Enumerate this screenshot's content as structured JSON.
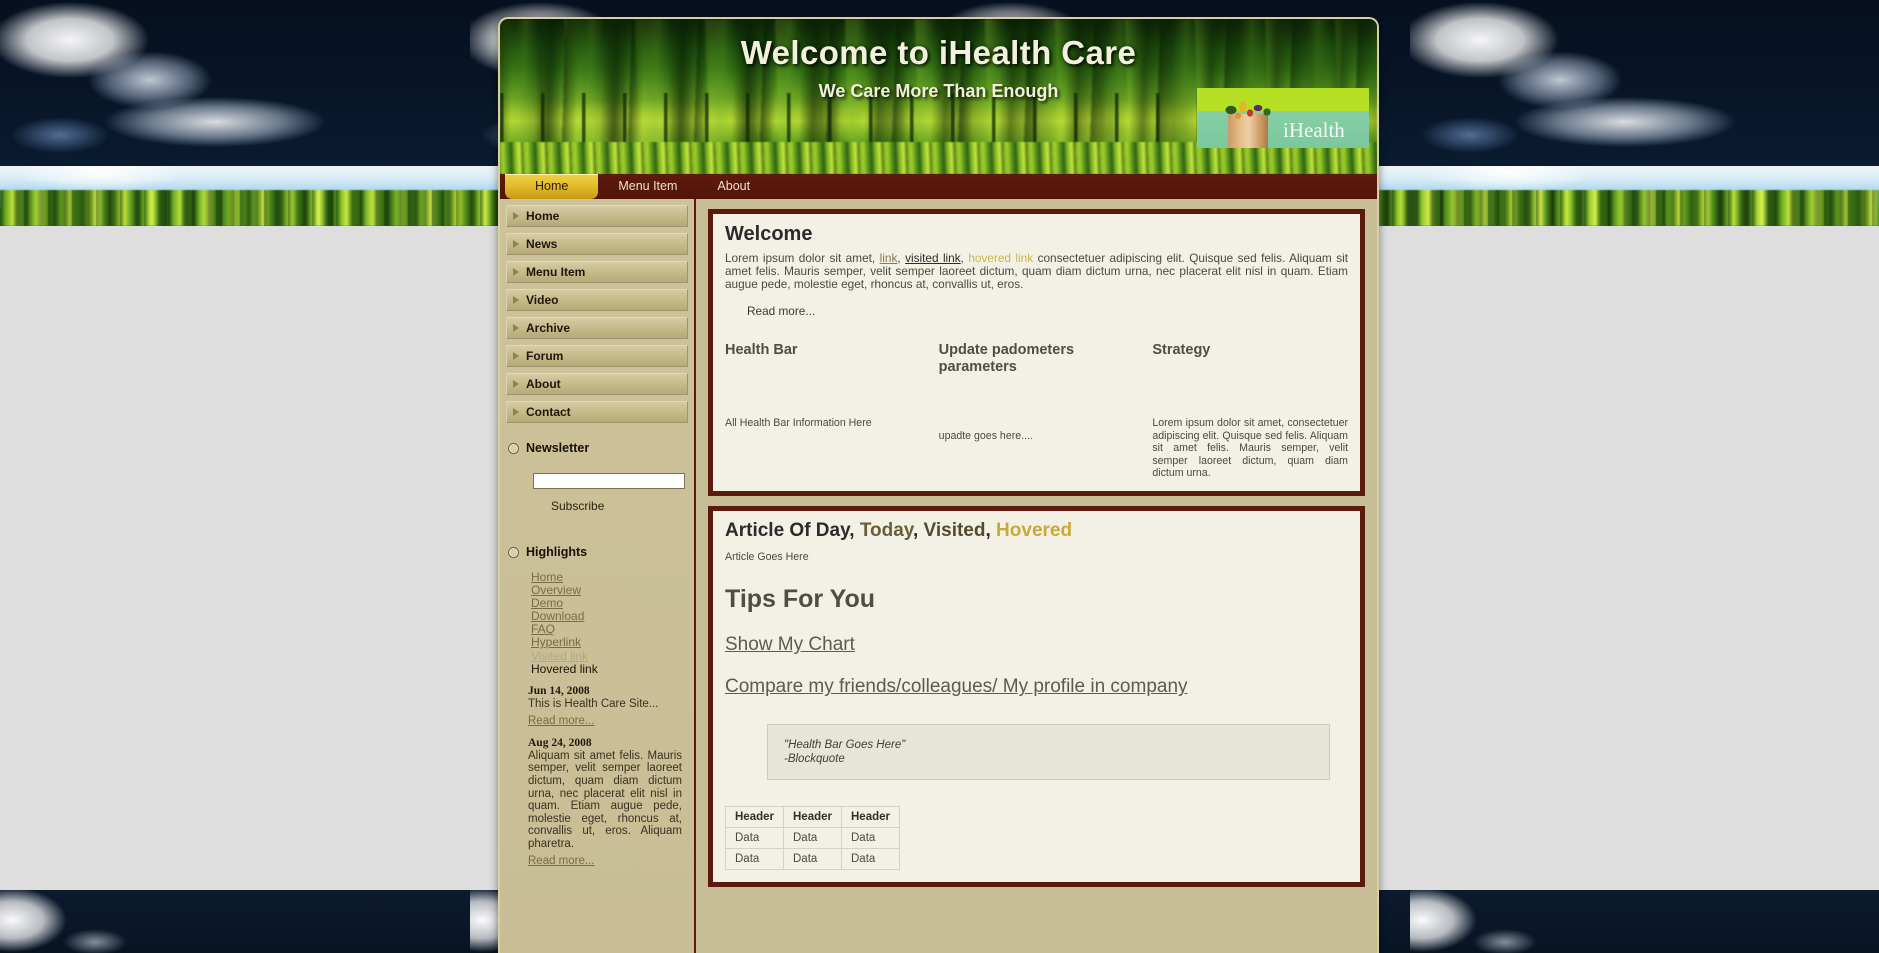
{
  "header": {
    "site_title": "Welcome to iHealth Care",
    "tagline": "We Care More Than Enough",
    "logo_text": "iHealth",
    "logo_icon": "grocery-bag-vegetables-icon"
  },
  "topnav": {
    "items": [
      {
        "label": "Home",
        "active": true
      },
      {
        "label": "Menu Item",
        "active": false
      },
      {
        "label": "About",
        "active": false
      }
    ]
  },
  "sidebar": {
    "menu": [
      {
        "label": "Home"
      },
      {
        "label": "News"
      },
      {
        "label": "Menu Item"
      },
      {
        "label": "Video"
      },
      {
        "label": "Archive"
      },
      {
        "label": "Forum"
      },
      {
        "label": "About"
      },
      {
        "label": "Contact"
      }
    ],
    "newsletter": {
      "title": "Newsletter",
      "bullet_icon": "ring-bullet-icon",
      "input_value": "",
      "input_placeholder": "",
      "subscribe_label": "Subscribe"
    },
    "highlights": {
      "title": "Highlights",
      "bullet_icon": "ring-bullet-icon",
      "links": [
        {
          "label": "Home",
          "state": "normal"
        },
        {
          "label": "Overview",
          "state": "normal"
        },
        {
          "label": "Demo",
          "state": "normal"
        },
        {
          "label": "Download",
          "state": "normal"
        },
        {
          "label": "FAQ",
          "state": "normal"
        },
        {
          "label": "Hyperlink",
          "state": "normal"
        },
        {
          "label": "Visited link",
          "state": "visited"
        },
        {
          "label": "Hovered link",
          "state": "hovered"
        }
      ]
    },
    "news": [
      {
        "date": "Jun 14, 2008",
        "body": "This is Health Care Site...",
        "more": "Read more..."
      },
      {
        "date": "Aug 24, 2008",
        "body": "Aliquam sit amet felis. Mauris semper, velit semper laoreet dictum, quam diam dictum urna, nec placerat elit nisl in quam. Etiam augue pede, molestie eget, rhoncus at, convallis ut, eros. Aliquam pharetra.",
        "more": "Read more..."
      }
    ]
  },
  "welcome_panel": {
    "heading": "Welcome",
    "para_1": "Lorem ipsum dolor sit amet, ",
    "link_normal": "link",
    "para_2": ", ",
    "link_visited": "visited link",
    "para_3": ", ",
    "link_hovered": "hovered link",
    "para_4": " consectetuer adipiscing elit. Quisque sed felis. Aliquam sit amet felis. Mauris semper, velit semper laoreet dictum, quam diam dictum urna, nec placerat elit nisl in quam. Etiam augue pede, molestie eget, rhoncus at, convallis ut, eros.",
    "read_more": "Read more...",
    "columns": [
      {
        "title": "Health Bar",
        "body": "All Health Bar Information Here"
      },
      {
        "title": "Update padometers parameters",
        "body": "upadte goes here...."
      },
      {
        "title": "Strategy",
        "body": "Lorem ipsum dolor sit amet, consectetuer adipiscing elit. Quisque sed felis. Aliquam sit amet felis. Mauris semper, velit semper laoreet dictum, quam diam dictum urna."
      }
    ]
  },
  "article_panel": {
    "heading_part_1": "Article Of Day",
    "heading_part_2": "Today",
    "heading_part_3": "Visited",
    "heading_part_4": "Hovered",
    "subtitle": "Article Goes Here",
    "tips_heading": "Tips For You",
    "link_chart": "Show My Chart",
    "link_compare": "Compare my friends/colleagues/ My profile in company",
    "blockquote_line_1": "\"Health Bar Goes Here\"",
    "blockquote_line_2": "-Blockquote",
    "table": {
      "headers": [
        "Header",
        "Header",
        "Header"
      ],
      "rows": [
        [
          "Data",
          "Data",
          "Data"
        ],
        [
          "Data",
          "Data",
          "Data"
        ]
      ]
    }
  },
  "colors": {
    "panel_border": "#5c1a0e",
    "panel_bg": "#f3f1e5",
    "nav_bar": "#5e1a10",
    "active_tab": "#e3bb28",
    "sidebar_bg": "#c8be95",
    "logo_green": "#b6e023",
    "logo_teal": "#7bc89e",
    "hovered_accent": "#c9a93a",
    "link": "#8a7a4d"
  }
}
